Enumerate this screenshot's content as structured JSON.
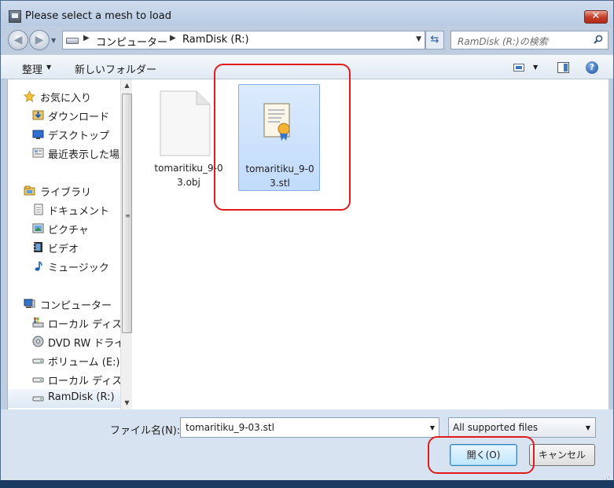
{
  "window": {
    "title": "Please select a mesh to load",
    "close_glyph": "✕"
  },
  "nav": {
    "back_glyph": "◀",
    "forward_glyph": "▶",
    "breadcrumb": [
      "コンピューター",
      "RamDisk (R:)"
    ],
    "search_placeholder": "RamDisk (R:)の検索"
  },
  "toolbar": {
    "organize": "整理",
    "new_folder": "新しいフォルダー",
    "help_glyph": "?"
  },
  "sidebar": {
    "items": [
      {
        "label": "お気に入り",
        "icon": "star-icon"
      },
      {
        "label": "ダウンロード",
        "icon": "downloads-icon"
      },
      {
        "label": "デスクトップ",
        "icon": "desktop-icon"
      },
      {
        "label": "最近表示した場所",
        "icon": "recent-places-icon"
      },
      {
        "label": "ライブラリ",
        "icon": "library-icon"
      },
      {
        "label": "ドキュメント",
        "icon": "documents-icon"
      },
      {
        "label": "ピクチャ",
        "icon": "pictures-icon"
      },
      {
        "label": "ビデオ",
        "icon": "videos-icon"
      },
      {
        "label": "ミュージック",
        "icon": "music-icon"
      },
      {
        "label": "コンピューター",
        "icon": "computer-icon"
      },
      {
        "label": "ローカル ディスク",
        "icon": "local-disk-icon"
      },
      {
        "label": "DVD RW ドライブ",
        "icon": "dvd-drive-icon"
      },
      {
        "label": "ボリューム (E:)",
        "icon": "volume-icon"
      },
      {
        "label": "ローカル ディスク",
        "icon": "local-disk-icon"
      },
      {
        "label": "RamDisk (R:)",
        "icon": "ramdisk-icon"
      }
    ]
  },
  "files": [
    {
      "name": "tomaritiku_9-03.obj",
      "label_line1": "tomaritiku_9-0",
      "label_line2": "3.obj",
      "icon": "blank-document-icon",
      "selected": false
    },
    {
      "name": "tomaritiku_9-03.stl",
      "label_line1": "tomaritiku_9-0",
      "label_line2": "3.stl",
      "icon": "certificate-document-icon",
      "selected": true
    }
  ],
  "footer": {
    "filename_label": "ファイル名(N):",
    "filename_value": "tomaritiku_9-03.stl",
    "filetype_value": "All supported files",
    "open_button": "開く(O)",
    "cancel_button": "キャンセル"
  },
  "colors": {
    "annotation_red": "#e11a1a",
    "selection_blue": "#c1dbfc"
  }
}
